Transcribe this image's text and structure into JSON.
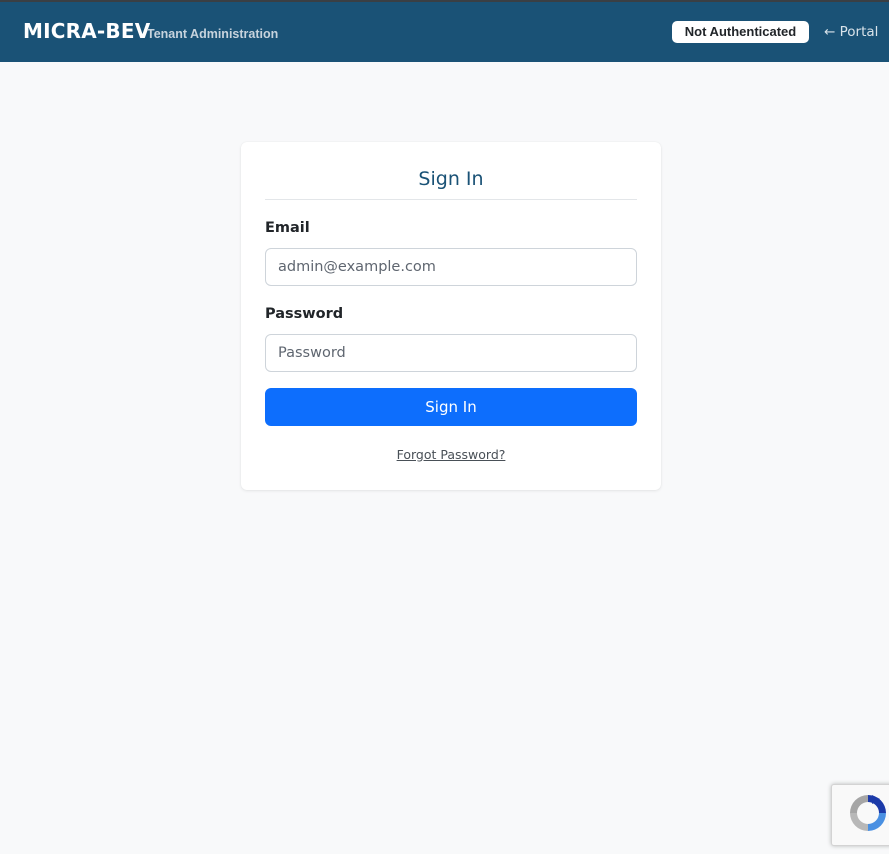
{
  "header": {
    "brand": "MICRA-BEV",
    "subtitle": "Tenant Administration",
    "auth_status": "Not Authenticated",
    "portal_link": "← Portal"
  },
  "signin": {
    "title": "Sign In",
    "email_label": "Email",
    "email_placeholder": "admin@example.com",
    "email_value": "",
    "password_label": "Password",
    "password_placeholder": "Password",
    "password_value": "",
    "submit_label": "Sign In",
    "forgot_link": "Forgot Password?"
  },
  "recaptcha": {
    "icon": "recaptcha-icon"
  },
  "colors": {
    "navbar": "#1a5276",
    "title": "#1a5276",
    "primary_button": "#0d6efd",
    "page_background": "#f8f9fa"
  }
}
